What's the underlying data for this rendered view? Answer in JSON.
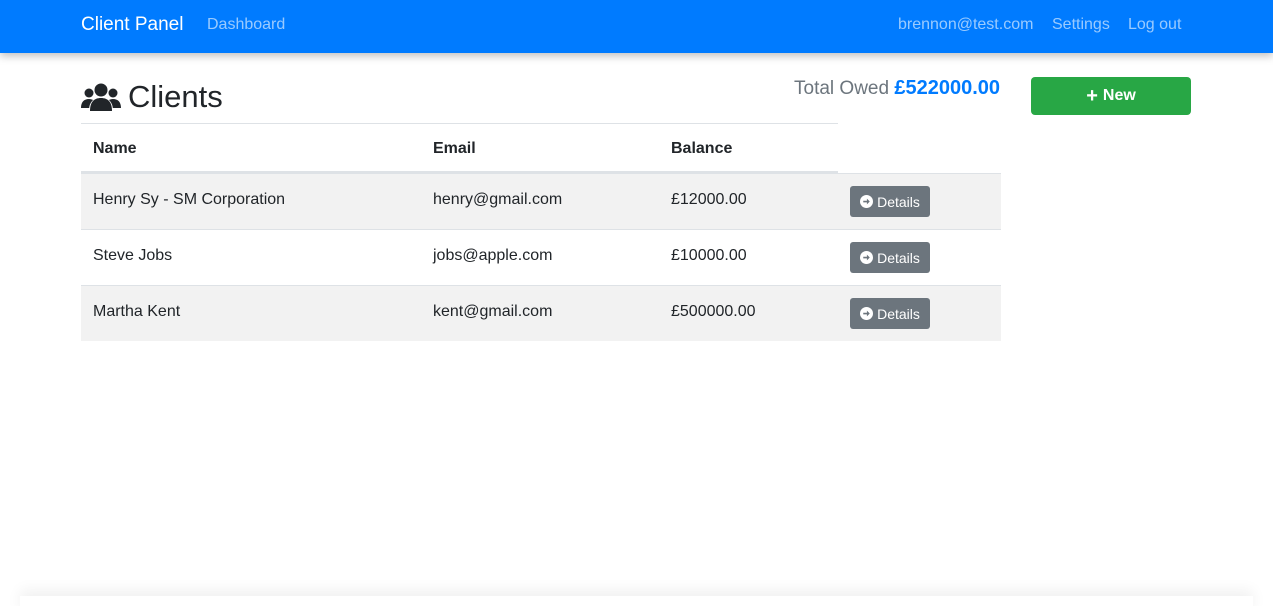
{
  "navbar": {
    "brand": "Client Panel",
    "dashboard": "Dashboard",
    "user_email": "brennon@test.com",
    "settings": "Settings",
    "logout": "Log out"
  },
  "page": {
    "title": "Clients",
    "title_icon": "users-icon",
    "total_owed_label": "Total Owed",
    "total_owed_amount": "£522000.00",
    "new_button_label": "New",
    "new_button_icon": "plus-icon"
  },
  "table": {
    "columns": [
      "Name",
      "Email",
      "Balance"
    ],
    "rows": [
      {
        "name": "Henry Sy - SM Corporation",
        "email": "henry@gmail.com",
        "balance": "£12000.00",
        "details_label": "Details"
      },
      {
        "name": "Steve Jobs",
        "email": "jobs@apple.com",
        "balance": "£10000.00",
        "details_label": "Details"
      },
      {
        "name": "Martha Kent",
        "email": "kent@gmail.com",
        "balance": "£500000.00",
        "details_label": "Details"
      }
    ]
  },
  "colors": {
    "navbar": "#007bff",
    "accent": "#007bff",
    "new_button": "#28a745",
    "details_button": "#6c757d"
  }
}
